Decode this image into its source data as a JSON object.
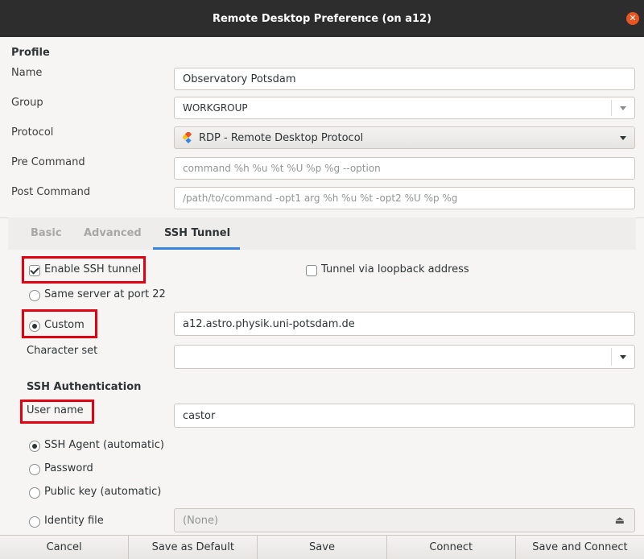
{
  "window": {
    "title": "Remote Desktop Preference (on a12)"
  },
  "profile": {
    "section_title": "Profile",
    "name_label": "Name",
    "name_value": "Observatory Potsdam",
    "group_label": "Group",
    "group_value": "WORKGROUP",
    "protocol_label": "Protocol",
    "protocol_value": "RDP - Remote Desktop Protocol",
    "precommand_label": "Pre Command",
    "precommand_placeholder": "command %h %u %t %U %p %g --option",
    "postcommand_label": "Post Command",
    "postcommand_placeholder": "/path/to/command -opt1 arg %h %u %t -opt2 %U %p %g"
  },
  "tabs": [
    {
      "label": "Basic"
    },
    {
      "label": "Advanced"
    },
    {
      "label": "SSH Tunnel"
    }
  ],
  "ssh": {
    "enable_label": "Enable SSH tunnel",
    "enable_checked": true,
    "loopback_label": "Tunnel via loopback address",
    "loopback_checked": false,
    "same_server_label": "Same server at port 22",
    "custom_label": "Custom",
    "custom_value": "a12.astro.physik.uni-potsdam.de",
    "charset_label": "Character set",
    "charset_value": "",
    "auth_title": "SSH Authentication",
    "username_label": "User name",
    "username_value": "castor",
    "auth_options": [
      {
        "label": "SSH Agent (automatic)",
        "checked": true
      },
      {
        "label": "Password",
        "checked": false
      },
      {
        "label": "Public key (automatic)",
        "checked": false
      },
      {
        "label": "Identity file",
        "checked": false
      }
    ],
    "identity_value": "(None)"
  },
  "buttons": {
    "cancel": "Cancel",
    "save_default": "Save as Default",
    "save": "Save",
    "connect": "Connect",
    "save_connect": "Save and Connect"
  },
  "colors": {
    "titlebar": "#2d2d2d",
    "close": "#e95420",
    "tab_underline": "#3584e4",
    "highlight_box": "#e3000f"
  }
}
